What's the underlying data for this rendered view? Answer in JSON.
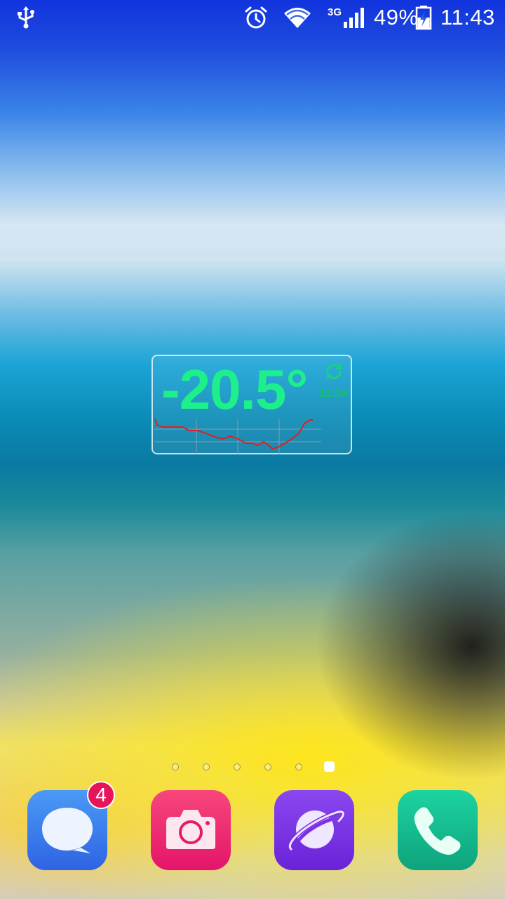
{
  "status_bar": {
    "network_type": "3G",
    "battery_percent": "49%",
    "time": "11:43",
    "icons": [
      "usb-icon",
      "alarm-icon",
      "wifi-icon",
      "signal-icon",
      "battery-charging-icon"
    ]
  },
  "widget": {
    "temperature": "-20.5°",
    "updated_time": "11:34",
    "refresh_icon": "refresh-icon",
    "colors": {
      "temperature": "#1df08a",
      "graph_line": "#e02020"
    }
  },
  "page_indicator": {
    "total": 6,
    "active_index": 5
  },
  "dock": {
    "apps": [
      {
        "icon": "messages-icon",
        "color": "#3f80ee",
        "badge": "4"
      },
      {
        "icon": "camera-icon",
        "color": "#ea2070"
      },
      {
        "icon": "browser-icon",
        "color": "#7a2ee0"
      },
      {
        "icon": "phone-icon",
        "color": "#14b888"
      }
    ]
  }
}
